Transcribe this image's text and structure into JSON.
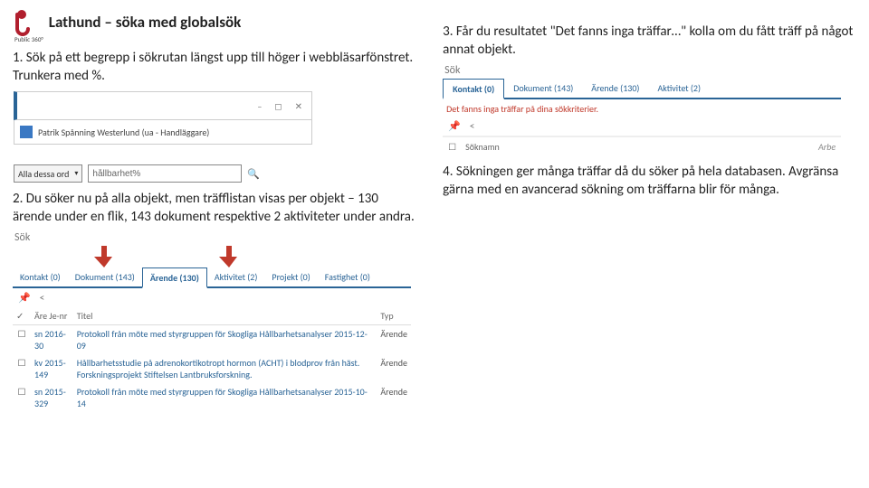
{
  "logo_label": "Public 360°",
  "title": "Lathund – söka med globalsök",
  "step1": "1. Sök på ett begrepp i sökrutan längst upp till höger i webbläsarfönstret. Trunkera med %.",
  "step2": "2. Du söker nu på alla objekt, men träfflistan visas per objekt – 130 ärende under en flik, 143 dokument respektive 2 aktiviteter under andra.",
  "step3": "3. Får du resultatet \"Det fanns inga träffar…\" kolla om du fått träff på något annat objekt.",
  "step4": "4. Sökningen ger många träffar då du söker på hela databasen. Avgränsa gärna med en avancerad sökning om träffarna blir för många.",
  "shot1": {
    "user": "Patrik Spånning Westerlund (ua - Handläggare)",
    "combo": "Alla dessa ord",
    "query": "hållbarhet%",
    "icons": [
      "–",
      "◻",
      "✕"
    ]
  },
  "shot2": {
    "sok": "Sök",
    "tabs": [
      "Kontakt (0)",
      "Dokument (143)",
      "Ärende (130)",
      "Aktivitet (2)",
      "Projekt (0)",
      "Fastighet (0)"
    ],
    "active_tab_index": 2,
    "headers": {
      "c1": "Äre Je-nr",
      "c2": "Titel",
      "c3": "Typ"
    },
    "rows": [
      {
        "id": "sn 2016-30",
        "title": "Protokoll från möte med styrgruppen för Skogliga Hållbarhetsanalyser 2015-12-09",
        "type": "Ärende"
      },
      {
        "id": "kv 2015-149",
        "title": "Hållbarhetsstudie på adrenokortikotropt hormon (ACHT) i blodprov från häst. Forskningsprojekt Stiftelsen Lantbruksforskning.",
        "type": "Ärende"
      },
      {
        "id": "sn 2015-329",
        "title": "Protokoll från möte med styrgruppen för Skogliga Hållbarhetsanalyser 2015-10-14",
        "type": "Ärende"
      }
    ]
  },
  "shot3": {
    "sok": "Sök",
    "tabs": [
      "Kontakt (0)",
      "Dokument (143)",
      "Ärende (130)",
      "Aktivitet (2)"
    ],
    "active_tab_index": 0,
    "message": "Det fanns inga träffar på dina sökkriterier.",
    "checkbox_label": "Söknamn",
    "right_col": "Arbe"
  }
}
